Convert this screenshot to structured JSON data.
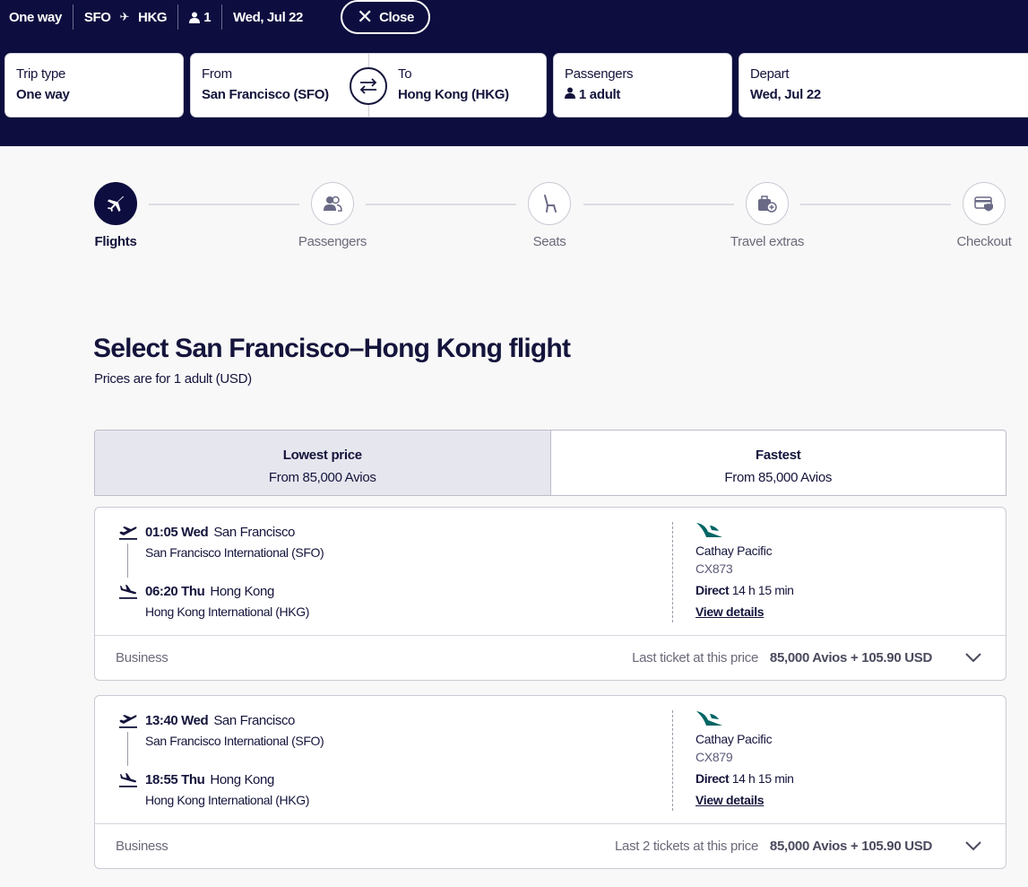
{
  "summary": {
    "trip": "One way",
    "origin": "SFO",
    "destination": "HKG",
    "pax_count": "1",
    "date": "Wed, Jul 22",
    "close_label": "Close",
    "plane_icon": "plane-icon",
    "person_icon": "person-icon"
  },
  "search": {
    "trip_type": {
      "label": "Trip type",
      "value": "One way"
    },
    "from": {
      "label": "From",
      "value": "San Francisco (SFO)"
    },
    "to": {
      "label": "To",
      "value": "Hong Kong (HKG)"
    },
    "passengers": {
      "label": "Passengers",
      "value": "1 adult"
    },
    "depart": {
      "label": "Depart",
      "value": "Wed, Jul 22"
    },
    "swap_icon": "swap-arrows-icon"
  },
  "steps": [
    {
      "label": "Flights",
      "icon": "plane-icon",
      "active": true
    },
    {
      "label": "Passengers",
      "icon": "passengers-icon",
      "active": false
    },
    {
      "label": "Seats",
      "icon": "seat-icon",
      "active": false
    },
    {
      "label": "Travel extras",
      "icon": "luggage-add-icon",
      "active": false
    },
    {
      "label": "Checkout",
      "icon": "card-shield-icon",
      "active": false
    }
  ],
  "page": {
    "title": "Select San Francisco–Hong Kong flight",
    "subtitle": "Prices are for 1 adult (USD)"
  },
  "tabs": [
    {
      "title": "Lowest price",
      "subtitle": "From 85,000 Avios",
      "selected": true
    },
    {
      "title": "Fastest",
      "subtitle": "From 85,000 Avios",
      "selected": false
    }
  ],
  "flights": [
    {
      "dep_time": "01:05 Wed",
      "dep_city": "San Francisco",
      "dep_airport": "San Francisco International (SFO)",
      "arr_time": "06:20 Thu",
      "arr_city": "Hong Kong",
      "arr_airport": "Hong Kong International (HKG)",
      "airline": "Cathay Pacific",
      "flight_no": "CX873",
      "stops": "Direct",
      "duration": "14 h 15 min",
      "details_link": "View details",
      "cabin": "Business",
      "availability": "Last ticket at this price",
      "price": "85,000 Avios + 105.90 USD"
    },
    {
      "dep_time": "13:40 Wed",
      "dep_city": "San Francisco",
      "dep_airport": "San Francisco International (SFO)",
      "arr_time": "18:55 Thu",
      "arr_city": "Hong Kong",
      "arr_airport": "Hong Kong International (HKG)",
      "airline": "Cathay Pacific",
      "flight_no": "CX879",
      "stops": "Direct",
      "duration": "14 h 15 min",
      "details_link": "View details",
      "cabin": "Business",
      "availability": "Last 2 tickets at this price",
      "price": "85,000 Avios + 105.90 USD"
    }
  ],
  "colors": {
    "navy": "#0d0d3f",
    "cathay_green": "#006564"
  }
}
